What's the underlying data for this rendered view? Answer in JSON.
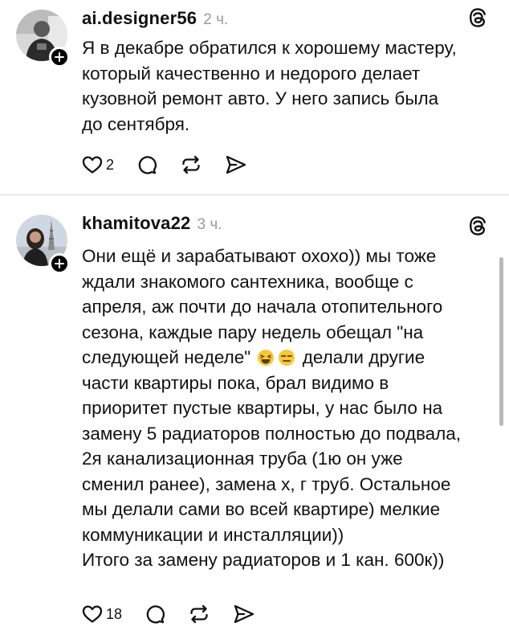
{
  "posts": [
    {
      "username": "ai.designer56",
      "time": "2 ч.",
      "text": "Я в декабре обратился к хорошему мастеру,\nкоторый качественно и недорого делает\nкузовной ремонт авто. У него запись была\nдо сентября.",
      "like_count": "2",
      "icons": [
        "heart-icon",
        "comment-icon",
        "repost-icon",
        "share-icon",
        "threads-icon",
        "follow-plus-icon"
      ]
    },
    {
      "username": "khamitova22",
      "time": "3 ч.",
      "text_before_emoji": "Они ещё и зарабатывают охохо)) мы тоже\nждали знакомого сантехника, вообще с\nапреля, аж почти до начала отопительного\nсезона, каждые пару недель обещал \"на\nследующей неделе\" ",
      "text_after_emoji": " делали другие\nчасти квартиры пока, брал видимо в\nприоритет пустые квартиры, у нас было на\nзамену 5 радиаторов полностью до подвала,\n2я канализационная труба (1ю он уже\nсменил ранее), замена х, г труб. Остальное\nмы делали сами во всей квартире) мелкие\nкоммуникации и инсталляции))\nИтого за замену радиаторов и 1 кан. 600к))",
      "emojis": [
        "laughing-emoji",
        "expressionless-emoji"
      ],
      "like_count": "18",
      "icons": [
        "heart-icon",
        "comment-icon",
        "repost-icon",
        "share-icon",
        "threads-icon",
        "follow-plus-icon"
      ]
    }
  ]
}
